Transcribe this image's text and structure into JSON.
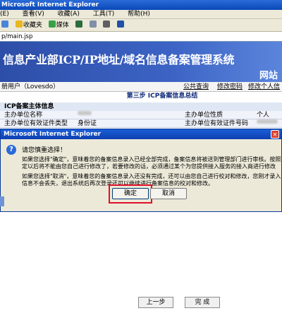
{
  "window": {
    "title": "Microsoft Internet Explorer"
  },
  "menu": {
    "items": [
      "(E)",
      "查看(V)",
      "收藏(A)",
      "工具(T)",
      "帮助(H)"
    ]
  },
  "toolbar": {
    "items": [
      "",
      "收藏夹",
      "媒体",
      "",
      "",
      "",
      ""
    ]
  },
  "address": {
    "url": "p/main.jsp"
  },
  "banner": {
    "title": "信息产业部ICP/IP地址/域名信息备案管理系统",
    "subtitle": "网站"
  },
  "nav": {
    "user": "册用户（Lovesdo）",
    "links": [
      "公共查询",
      "修改密码",
      "修改个人信"
    ]
  },
  "step_title": "第三步  ICP备案信息总结",
  "section": {
    "title": "ICP备案主体信息",
    "rows": [
      {
        "label": "主办单位名称",
        "value": "",
        "label2": "主办单位性质",
        "value2": "个人"
      },
      {
        "label": "主办单位有效证件类型",
        "value": "身份证",
        "label2": "主办单位有效证件号码",
        "value2": ""
      }
    ]
  },
  "dialog": {
    "title": "Microsoft Internet Explorer",
    "question": "请您慎重选择！",
    "para1_line1": "如果您选择\"确定\"，意味着您的备案信息录入已经全部完成，备案信息将被送到管理部门进行审核。按照",
    "para1_line2": "定以后将不能由您自己进行修改了，若要修改的话，必须通过某个为您提供接入服务的接入商进行修改",
    "para2_line1": "如果您选择\"取消\"，意味着您的备案信息录入还没有完成，还可以由您自己进行校对和修改，您刚才录入",
    "para2_line2": "信息不会丢失，退出系统后再次登录还可以继续进行备案信息的校对和修改。",
    "ok_label": "确定",
    "cancel_label": "取消"
  },
  "page_buttons": {
    "prev": "上一步",
    "finish": "完 成"
  }
}
